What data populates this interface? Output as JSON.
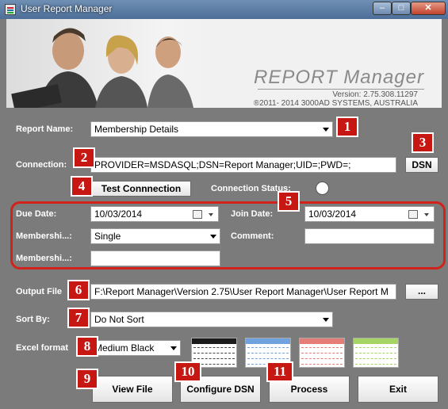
{
  "window": {
    "title": "User Report Manager",
    "minimize_glyph": "–",
    "maximize_glyph": "□",
    "close_glyph": "✕"
  },
  "header": {
    "brand": "REPORT Manager",
    "version": "Version: 2.75.308.11297",
    "copyright": "®2011- 2014 3000AD SYSTEMS,  AUSTRALIA"
  },
  "form": {
    "report_name_label": "Report Name:",
    "report_name_value": "Membership Details",
    "connection_label": "Connection:",
    "connection_value": "PROVIDER=MSDASQL;DSN=Report Manager;UID=;PWD=;",
    "dsn_label": "DSN",
    "test_connection_label": "Test Connnection",
    "connection_status_label": "Connection Status:",
    "due_date_label": "Due Date:",
    "due_date_value": "10/03/2014",
    "join_date_label": "Join Date:",
    "join_date_value": "10/03/2014",
    "membership1_label": "Membershi...:",
    "membership1_value": "Single",
    "comment_label": "Comment:",
    "comment_value": "",
    "membership2_label": "Membershi...:",
    "membership2_value": "",
    "output_file_label": "Output File",
    "output_file_value": "F:\\Report Manager\\Version 2.75\\User Report Manager\\User Report M",
    "browse_label": "...",
    "sort_by_label": "Sort By:",
    "sort_by_value": "Do Not Sort",
    "excel_format_label": "Excel format",
    "excel_format_value": "Medium Black"
  },
  "buttons": {
    "view_file": "View File",
    "configure_dsn": "Configure DSN",
    "process": "Process",
    "exit": "Exit"
  },
  "swatches": [
    {
      "name": "black",
      "header_color": "#1a1a1a",
      "row_color": "#444444"
    },
    {
      "name": "blue",
      "header_color": "#6fa3dd",
      "row_color": "#6fa3dd"
    },
    {
      "name": "red",
      "header_color": "#e57c78",
      "row_color": "#e57c78"
    },
    {
      "name": "green",
      "header_color": "#a6d465",
      "row_color": "#a6d465"
    }
  ],
  "callouts": [
    "1",
    "2",
    "3",
    "4",
    "5",
    "6",
    "7",
    "8",
    "9",
    "10",
    "11"
  ],
  "colors": {
    "callout_red": "#c71712",
    "panel_gray": "#7b7b7b"
  }
}
